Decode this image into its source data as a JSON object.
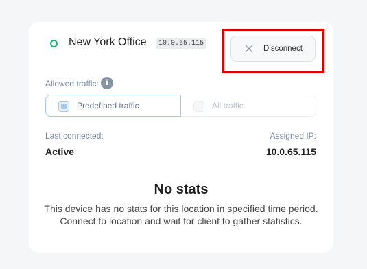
{
  "location": {
    "name": "New York Office",
    "ip": "10.0.65.115",
    "status_color": "#14bc6e"
  },
  "actions": {
    "disconnect_label": "Disconnect",
    "disconnect_icon": "close-icon"
  },
  "traffic": {
    "label": "Allowed traffic:",
    "info_icon": "i",
    "options": [
      {
        "label": "Predefined traffic",
        "selected": true
      },
      {
        "label": "All traffic",
        "selected": false
      }
    ]
  },
  "details": {
    "last_connected_label": "Last connected:",
    "last_connected_value": "Active",
    "assigned_ip_label": "Assigned IP:",
    "assigned_ip_value": "10.0.65.115"
  },
  "stats": {
    "title": "No stats",
    "description": "This device has no stats for this location in specified time period. Connect to location and wait for client to gather statistics."
  },
  "colors": {
    "highlight": "#e00000",
    "accent": "#a9c7e6"
  }
}
